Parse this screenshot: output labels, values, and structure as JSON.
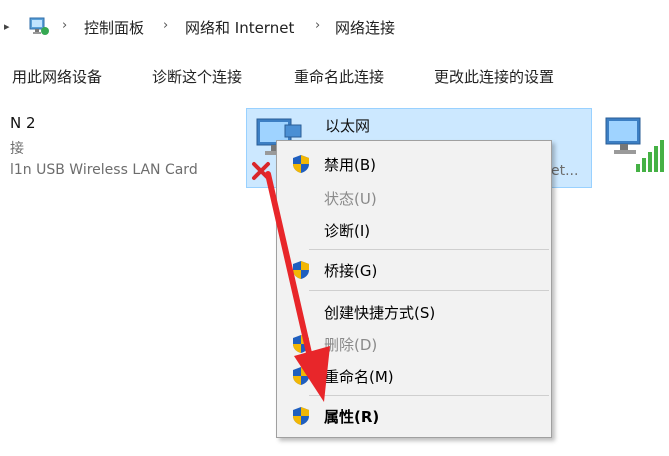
{
  "breadcrumb": {
    "items": [
      "控制面板",
      "网络和 Internet",
      "网络连接"
    ]
  },
  "toolbar": {
    "commands": [
      "用此网络设备",
      "诊断这个连接",
      "重命名此连接",
      "更改此连接的设置"
    ]
  },
  "adapters": {
    "left": {
      "name": "N 2",
      "status": "接",
      "device": "l1n USB Wireless LAN Card"
    },
    "selected": {
      "name": "以太网",
      "device_tail": "et..."
    }
  },
  "context_menu": {
    "items": [
      {
        "label": "禁用(B)",
        "shield": true,
        "disabled": false,
        "bold": false
      },
      {
        "label": "状态(U)",
        "shield": false,
        "disabled": true,
        "bold": false
      },
      {
        "label": "诊断(I)",
        "shield": false,
        "disabled": false,
        "bold": false
      },
      {
        "label": "桥接(G)",
        "shield": true,
        "disabled": false,
        "bold": false
      },
      {
        "label": "创建快捷方式(S)",
        "shield": false,
        "disabled": false,
        "bold": false
      },
      {
        "label": "删除(D)",
        "shield": true,
        "disabled": true,
        "bold": false
      },
      {
        "label": "重命名(M)",
        "shield": true,
        "disabled": false,
        "bold": false
      },
      {
        "label": "属性(R)",
        "shield": true,
        "disabled": false,
        "bold": true
      }
    ]
  },
  "colors": {
    "selection_bg": "#cce8ff",
    "arrow": "#e8262a",
    "shield_blue": "#1f5fbf",
    "shield_gold": "#f2b705"
  }
}
